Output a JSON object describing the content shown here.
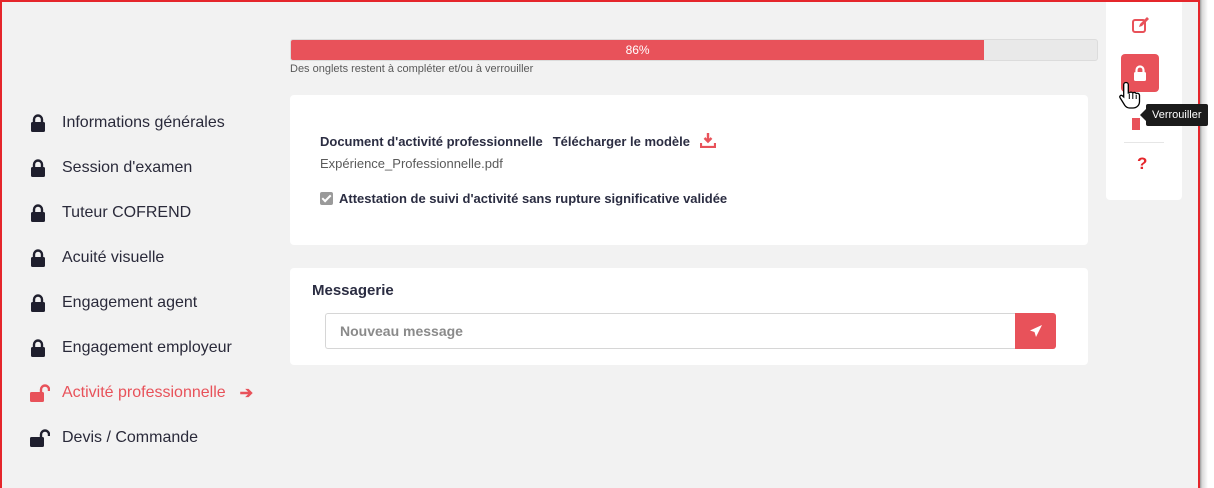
{
  "progress": {
    "percent_label": "86%",
    "percent_value": 86,
    "caption": "Des onglets restent à compléter et/ou à verrouiller",
    "fill_color": "#e8525a"
  },
  "sidebar": {
    "items": [
      {
        "label": "Informations générales",
        "state": "locked",
        "active": false
      },
      {
        "label": "Session d'examen",
        "state": "locked",
        "active": false
      },
      {
        "label": "Tuteur COFREND",
        "state": "locked",
        "active": false
      },
      {
        "label": "Acuité visuelle",
        "state": "locked",
        "active": false
      },
      {
        "label": "Engagement agent",
        "state": "locked",
        "active": false
      },
      {
        "label": "Engagement employeur",
        "state": "locked",
        "active": false
      },
      {
        "label": "Activité professionnelle",
        "state": "unlocked",
        "active": true
      },
      {
        "label": "Devis / Commande",
        "state": "unlocked",
        "active": false
      }
    ]
  },
  "document": {
    "title": "Document d'activité professionnelle",
    "download_label": "Télécharger le modèle",
    "file_name": "Expérience_Professionnelle.pdf",
    "attestation_label": "Attestation de suivi d'activité sans rupture significative validée",
    "attestation_checked": true
  },
  "messaging": {
    "title": "Messagerie",
    "input_placeholder": "Nouveau message"
  },
  "actions": {
    "tooltip": "Verrouiller",
    "help": "?"
  },
  "colors": {
    "accent": "#e8525a",
    "frame_border": "#e5262b",
    "text_dark": "#2b2d42"
  }
}
